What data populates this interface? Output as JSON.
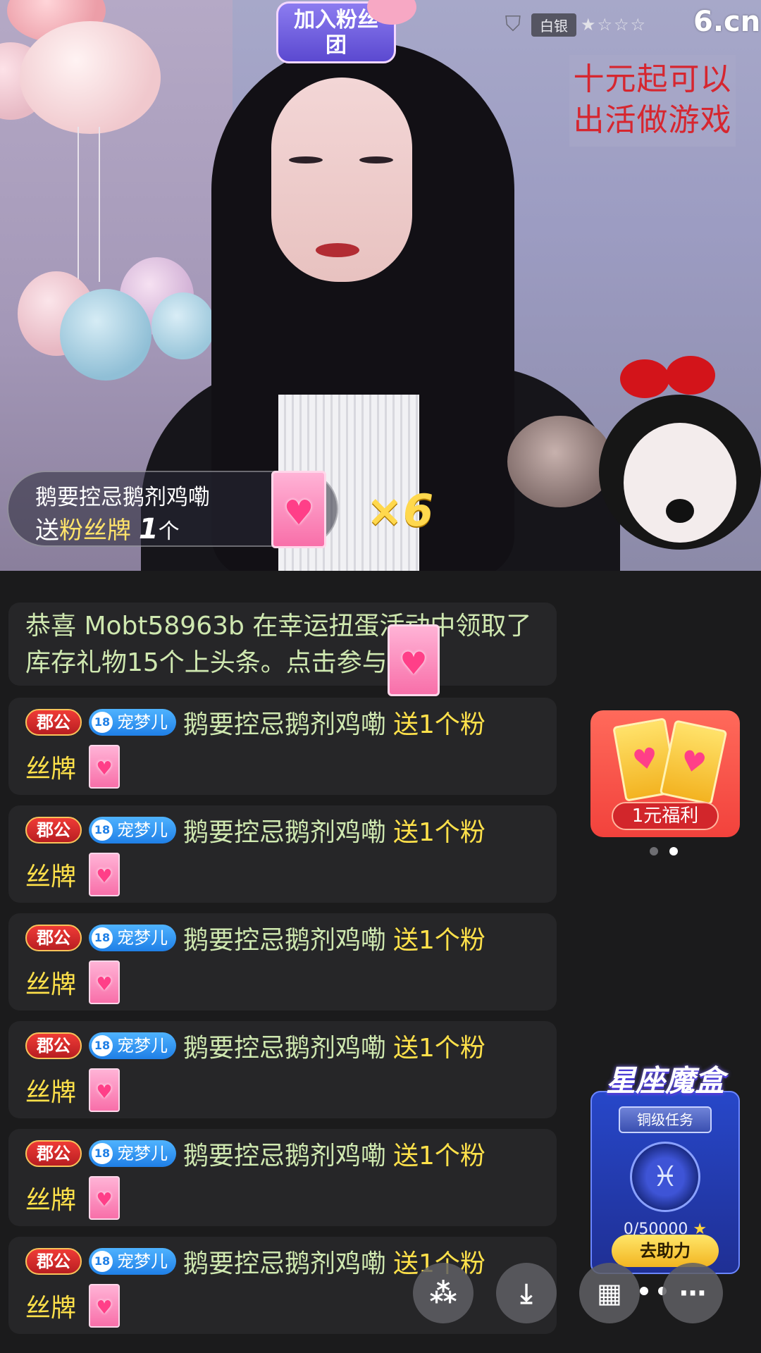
{
  "video": {
    "fan_group_badge": "加入粉丝团",
    "rank_label": "白银",
    "rank_stars": "★☆☆☆",
    "site_logo": "6.cn",
    "promo_line1": "十元起可以",
    "promo_line2": "出活做游戏",
    "gift_notice": {
      "sender": "鹅要控忌鹅剂鸡嘞",
      "send_word": "送",
      "gift_name": "粉丝牌",
      "count": "1",
      "unit": "个",
      "combo": "×6"
    }
  },
  "announcement": {
    "text": "恭喜 Mobt58963b 在幸运扭蛋活动中领取了库存礼物15个上头条。点击参与~",
    "go_icon": "›"
  },
  "chat": {
    "messages": [
      {
        "noble": "郡公",
        "fan_level": "18",
        "fan_name": "宠梦儿",
        "user": "鹅要控忌鹅剂鸡嘞",
        "action": "送1个粉",
        "tail": "丝牌"
      },
      {
        "noble": "郡公",
        "fan_level": "18",
        "fan_name": "宠梦儿",
        "user": "鹅要控忌鹅剂鸡嘞",
        "action": "送1个粉",
        "tail": "丝牌"
      },
      {
        "noble": "郡公",
        "fan_level": "18",
        "fan_name": "宠梦儿",
        "user": "鹅要控忌鹅剂鸡嘞",
        "action": "送1个粉",
        "tail": "丝牌"
      },
      {
        "noble": "郡公",
        "fan_level": "18",
        "fan_name": "宠梦儿",
        "user": "鹅要控忌鹅剂鸡嘞",
        "action": "送1个粉",
        "tail": "丝牌"
      },
      {
        "noble": "郡公",
        "fan_level": "18",
        "fan_name": "宠梦儿",
        "user": "鹅要控忌鹅剂鸡嘞",
        "action": "送1个粉",
        "tail": "丝牌"
      },
      {
        "noble": "郡公",
        "fan_level": "18",
        "fan_name": "宠梦儿",
        "user": "鹅要控忌鹅剂鸡嘞",
        "action": "送1个粉",
        "tail": "丝牌"
      }
    ]
  },
  "widgets": {
    "welfare_label": "1元福利",
    "zodiac_title": "星座魔盒",
    "zodiac_task": "铜级任务",
    "zodiac_progress": "0/50000",
    "zodiac_help": "去助力"
  },
  "actions": {
    "share_icon": "share-icon",
    "download_icon": "download-icon",
    "apps_icon": "apps-icon",
    "more_icon": "more-icon"
  }
}
